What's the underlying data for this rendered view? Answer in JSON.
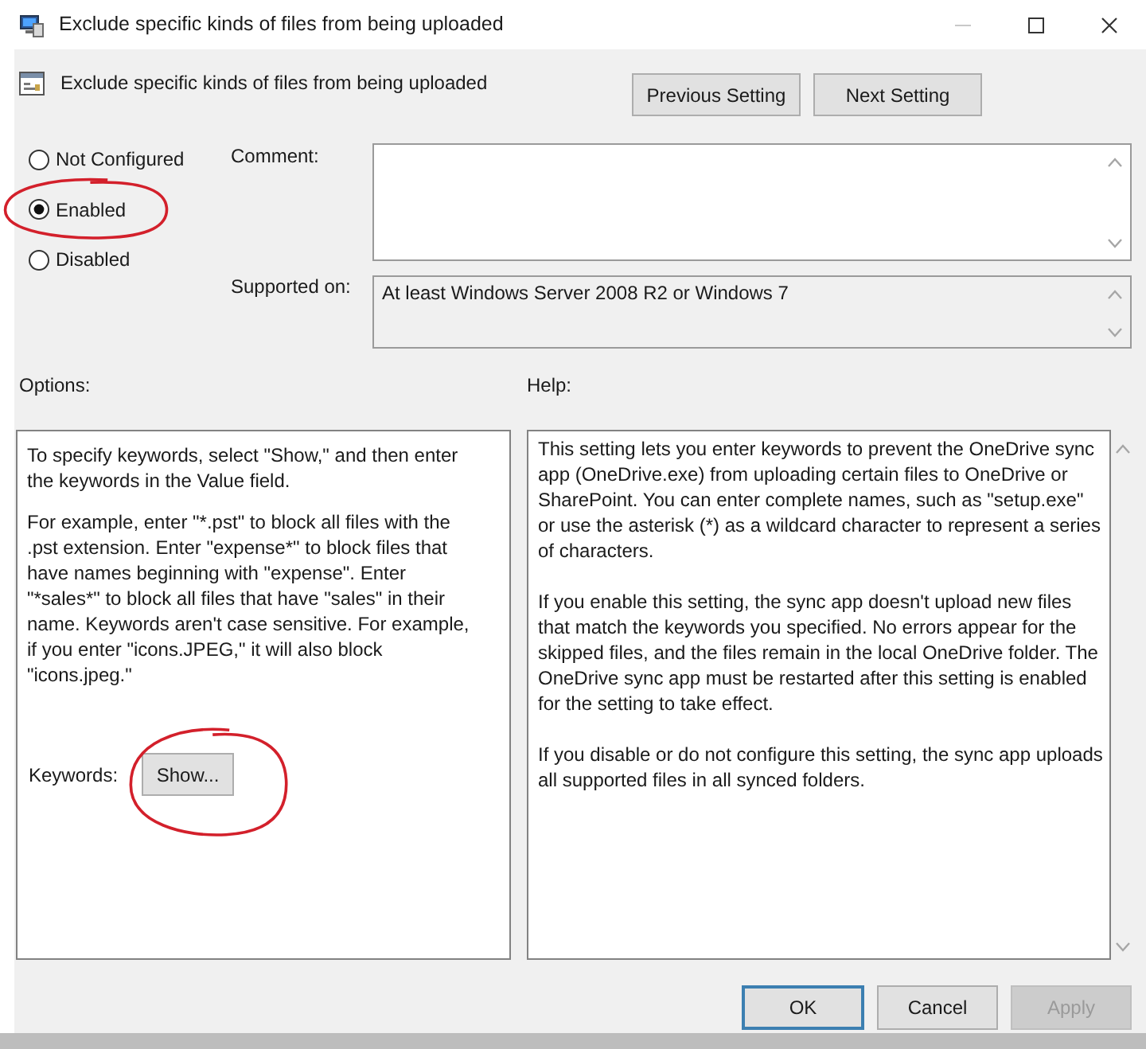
{
  "window": {
    "title": "Exclude specific kinds of files from being uploaded"
  },
  "header": {
    "title": "Exclude specific kinds of files from being uploaded",
    "buttons": [
      {
        "label": "Previous Setting"
      },
      {
        "label": "Next Setting"
      }
    ]
  },
  "state_options": [
    {
      "label": "Not Configured",
      "selected": false,
      "circled": false
    },
    {
      "label": "Enabled",
      "selected": true,
      "circled": true
    },
    {
      "label": "Disabled",
      "selected": false,
      "circled": false
    }
  ],
  "comment": {
    "label": "Comment:"
  },
  "supported_on": {
    "label": "Supported on:",
    "value": "At least Windows Server 2008 R2 or Windows 7"
  },
  "options": {
    "label": "Options:",
    "paragraphs": [
      "To specify keywords, select \"Show,\" and then enter the keywords in the Value field.",
      "For example, enter \"*.pst\" to block all files with the .pst extension. Enter \"expense*\" to block files that have names beginning with \"expense\". Enter \"*sales*\" to block all files that have \"sales\" in their name. Keywords aren't case sensitive. For example, if you enter \"icons.JPEG,\" it will also block \"icons.jpeg.\""
    ],
    "keywords": {
      "label": "Keywords:",
      "button": "Show...",
      "circled": true
    }
  },
  "help": {
    "label": "Help:",
    "paragraphs": [
      "This setting lets you enter keywords to prevent the OneDrive sync app (OneDrive.exe) from uploading certain files to OneDrive or SharePoint. You can enter complete names, such as \"setup.exe\" or use the asterisk (*) as a wildcard character to represent a series of characters.",
      "If you enable this setting, the sync app doesn't upload new files that match the keywords you specified. No errors appear for the skipped files, and the files remain in the local OneDrive folder. The OneDrive sync app must be restarted after this setting is enabled for the setting to take effect.",
      "If you disable or do not configure this setting, the sync app uploads all supported files in all synced folders."
    ]
  },
  "footer_buttons": [
    {
      "label": "OK",
      "focused": true,
      "disabled": false
    },
    {
      "label": "Cancel",
      "focused": false,
      "disabled": false
    },
    {
      "label": "Apply",
      "focused": false,
      "disabled": true
    }
  ]
}
